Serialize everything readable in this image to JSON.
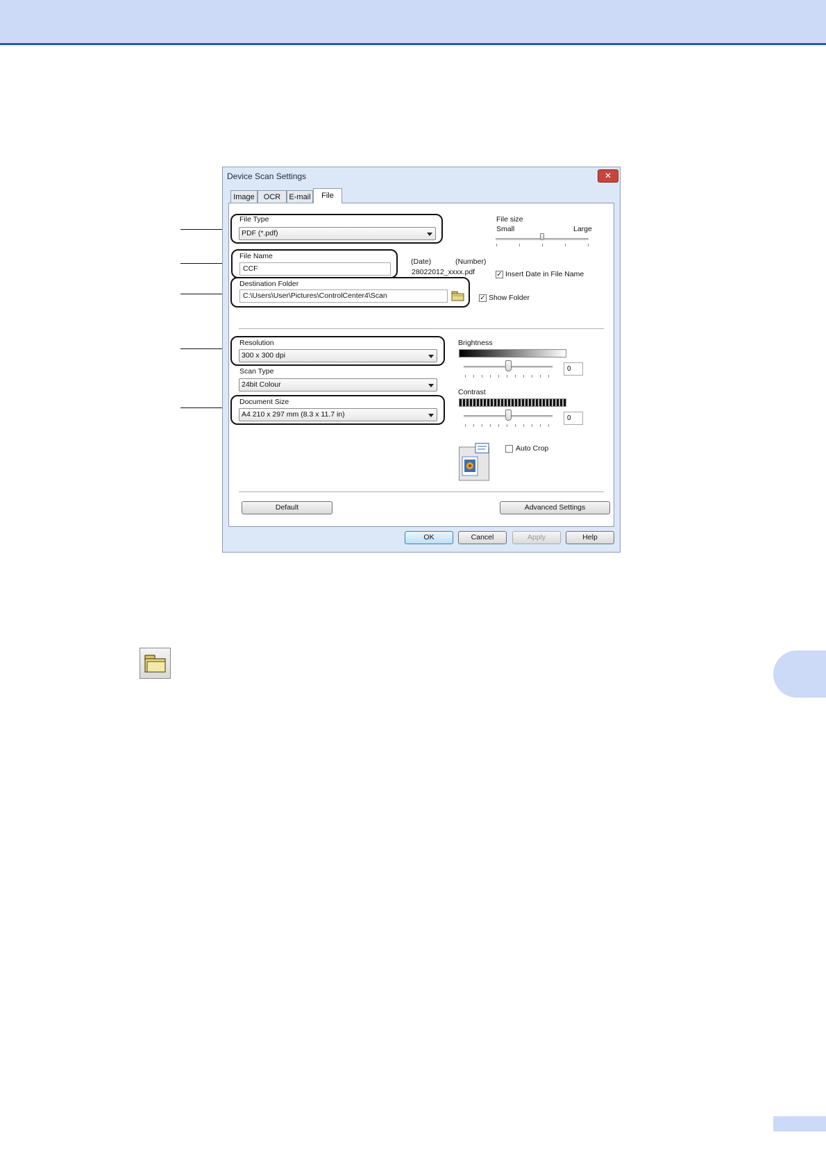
{
  "dialog": {
    "title": "Device Scan Settings",
    "close_symbol": "✕",
    "tabs": [
      {
        "label": "Image",
        "active": false
      },
      {
        "label": "OCR",
        "active": false
      },
      {
        "label": "E-mail",
        "active": false
      },
      {
        "label": "File",
        "active": true
      }
    ],
    "file_type": {
      "label": "File Type",
      "value": "PDF (*.pdf)"
    },
    "file_size": {
      "label": "File size",
      "min_label": "Small",
      "max_label": "Large",
      "level": 0.5
    },
    "file_name": {
      "label": "File Name",
      "value": "CCF"
    },
    "name_preview": {
      "date_label": "(Date)",
      "number_label": "(Number)",
      "example": "28022012_xxxx.pdf"
    },
    "insert_date": {
      "label": "Insert Date in File Name",
      "checked": true
    },
    "destination": {
      "label": "Destination Folder",
      "value": "C:\\Users\\User\\Pictures\\ControlCenter4\\Scan"
    },
    "show_folder": {
      "label": "Show Folder",
      "checked": true
    },
    "resolution": {
      "label": "Resolution",
      "value": "300 x 300 dpi"
    },
    "scan_type": {
      "label": "Scan Type",
      "value": "24bit Colour"
    },
    "document_size": {
      "label": "Document Size",
      "value": "A4 210 x 297 mm (8.3 x 11.7 in)"
    },
    "brightness": {
      "label": "Brightness",
      "value": "0",
      "level": 0.5
    },
    "contrast": {
      "label": "Contrast",
      "value": "0",
      "level": 0.5
    },
    "auto_crop": {
      "label": "Auto Crop",
      "checked": false
    },
    "buttons": {
      "default": "Default",
      "advanced": "Advanced Settings",
      "ok": "OK",
      "cancel": "Cancel",
      "apply": "Apply",
      "help": "Help"
    }
  },
  "icons": [
    "folder-browse-icon",
    "auto-crop-preview-icon",
    "check-icon"
  ],
  "colors": {
    "header_band": "#ccd9f7",
    "header_rule": "#2a56c6",
    "dialog_bg": "#dce8f7",
    "close_button": "#c7453b"
  }
}
